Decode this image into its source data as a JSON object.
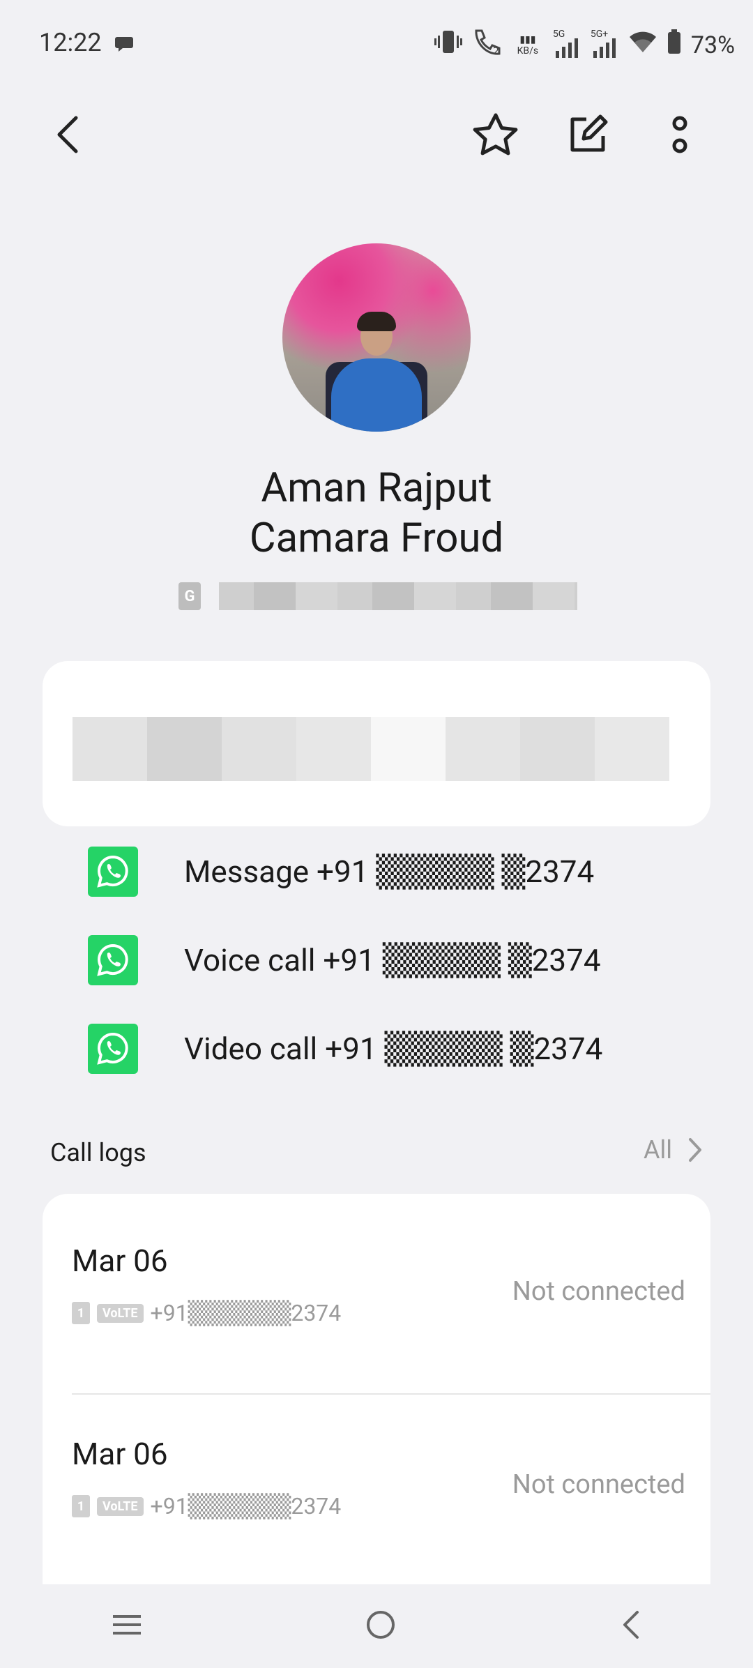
{
  "status_bar": {
    "time": "12:22",
    "net_speed_top": "▮▮▮",
    "net_speed_unit": "KB/s",
    "signal1_label": "5G",
    "signal2_label": "5G+",
    "battery": "73%"
  },
  "contact": {
    "first_line": "Aman Rajput",
    "second_line": "Camara Froud",
    "account_badge": "G"
  },
  "whatsapp_actions": [
    {
      "label": "Message +91 ▒▒▒▒▒ ▒2374"
    },
    {
      "label": "Voice call +91 ▒▒▒▒▒ ▒2374"
    },
    {
      "label": "Video call +91 ▒▒▒▒▒ ▒2374"
    }
  ],
  "call_logs": {
    "title": "Call logs",
    "all_label": "All",
    "items": [
      {
        "date": "Mar 06",
        "sim": "1",
        "tech": "VoLTE",
        "number": "+91▒▒▒▒▒▒2374",
        "status": "Not connected"
      },
      {
        "date": "Mar 06",
        "sim": "1",
        "tech": "VoLTE",
        "number": "+91▒▒▒▒▒▒2374",
        "status": "Not connected"
      }
    ]
  },
  "colors": {
    "background": "#f1f1f4",
    "whatsapp_green": "#25d366",
    "muted_text": "#9a9a9a"
  }
}
